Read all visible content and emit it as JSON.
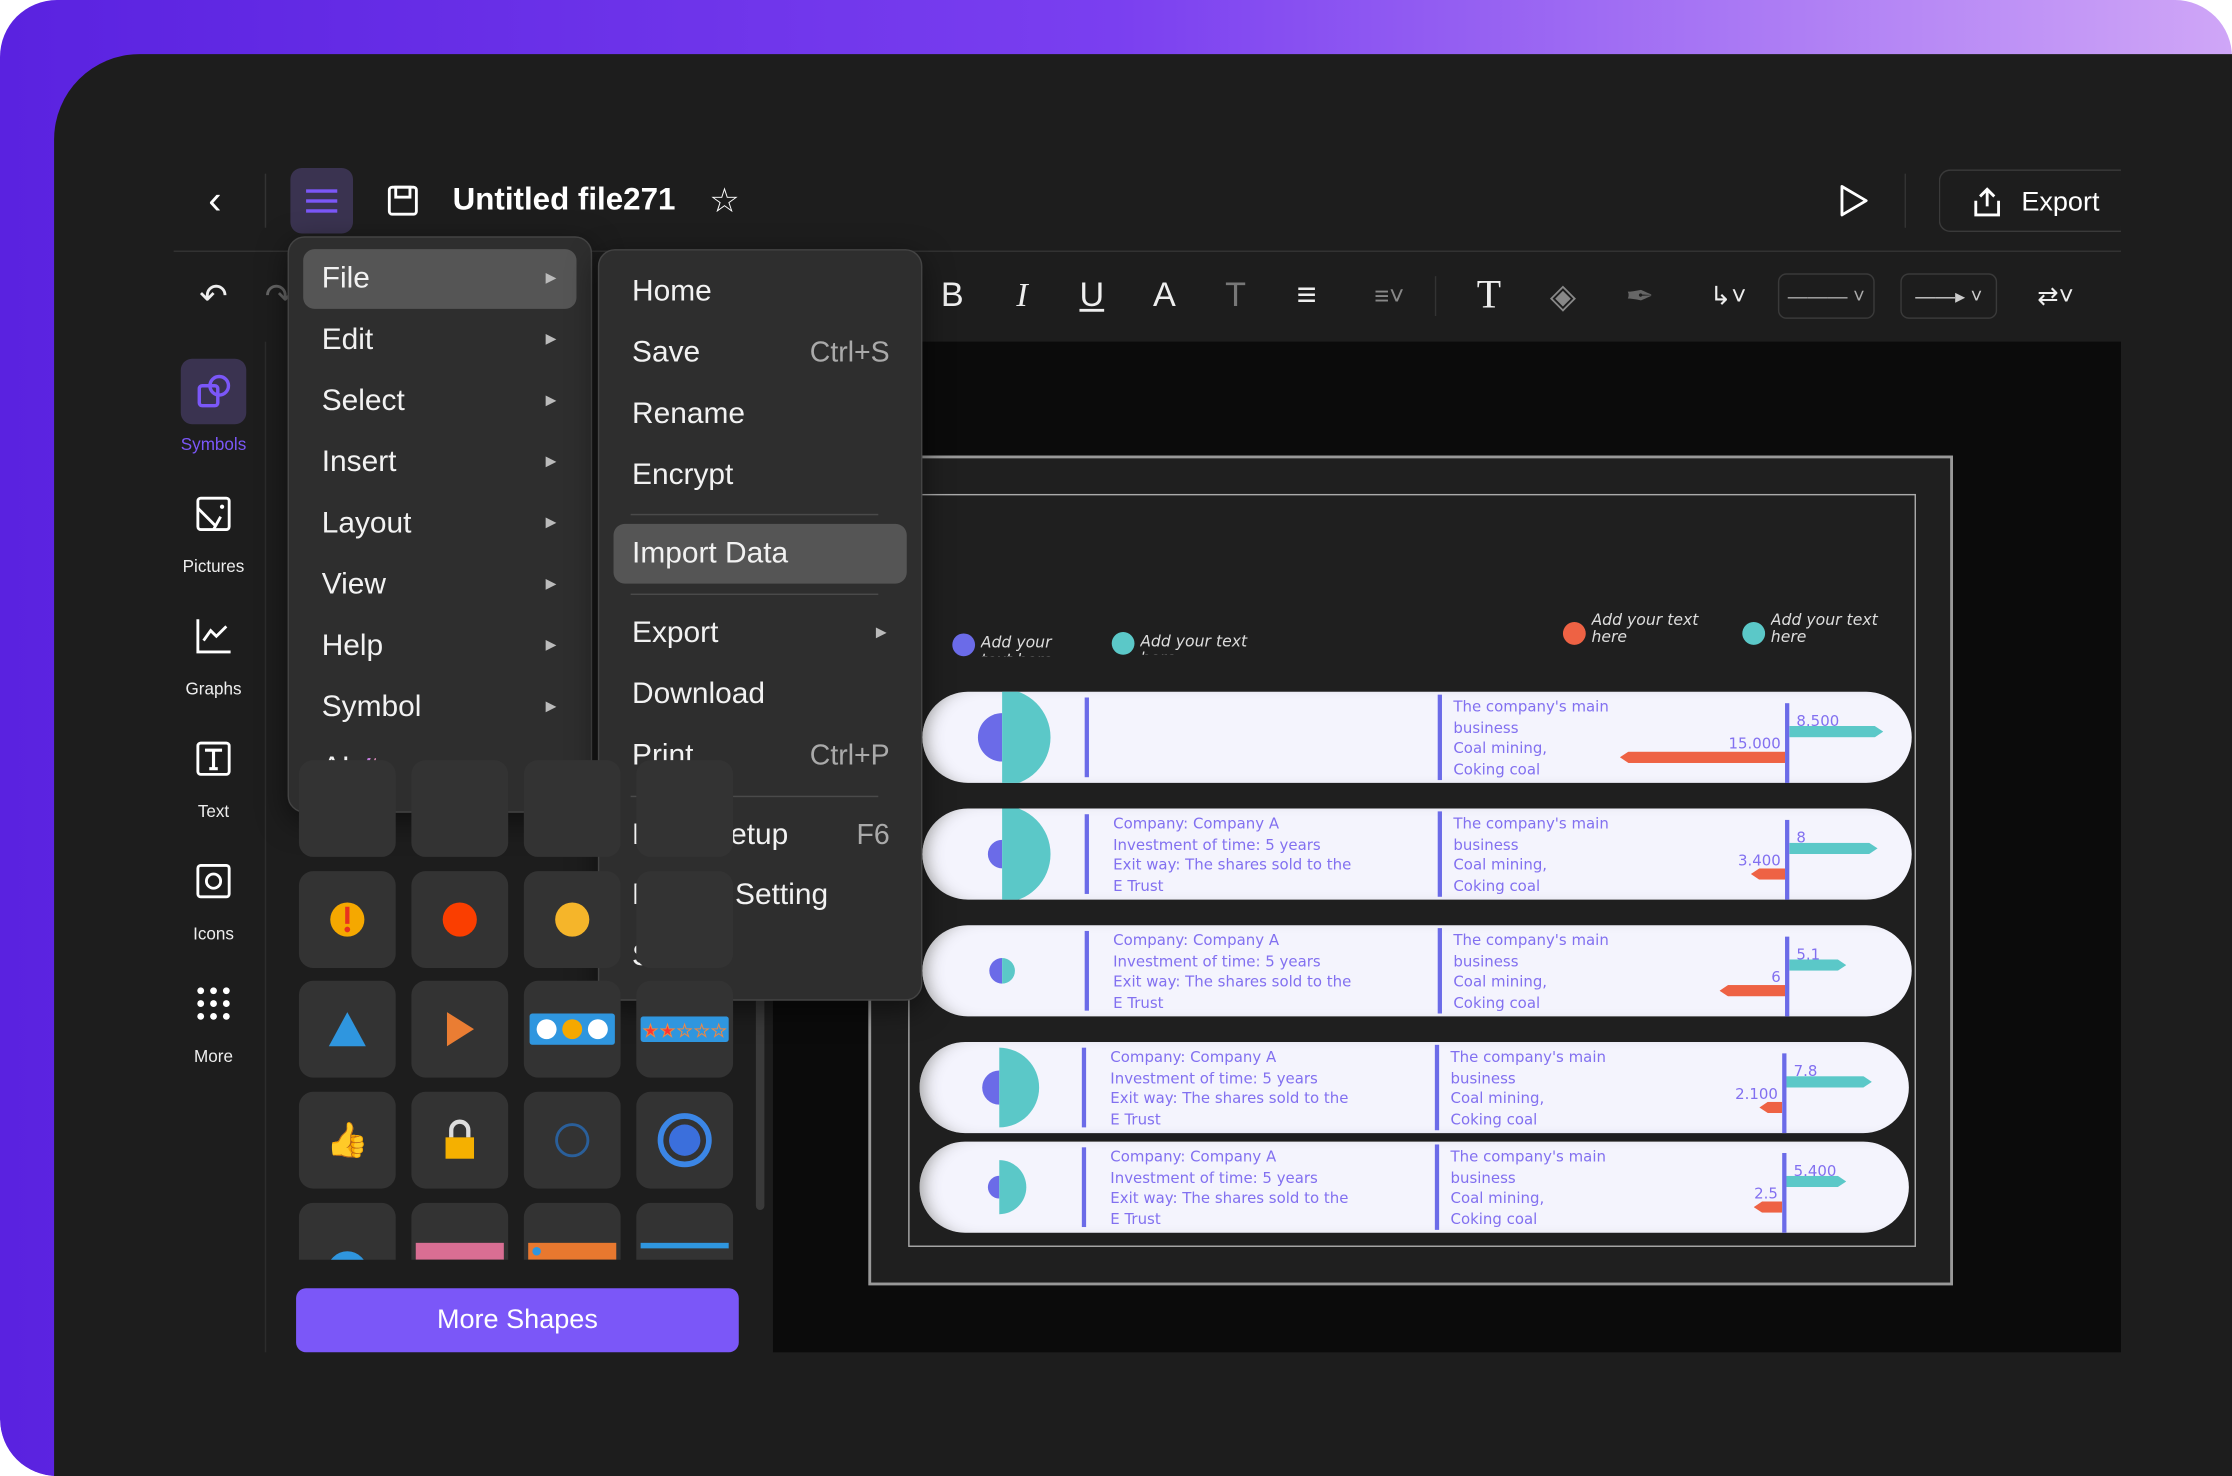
{
  "header": {
    "title": "Untitled file271",
    "export_label": "Export"
  },
  "rail": [
    {
      "label": "Symbols",
      "icon": "symbols-icon",
      "active": true
    },
    {
      "label": "Pictures",
      "icon": "picture-icon"
    },
    {
      "label": "Graphs",
      "icon": "graph-icon"
    },
    {
      "label": "Text",
      "icon": "text-icon"
    },
    {
      "label": "Icons",
      "icon": "icons-icon"
    },
    {
      "label": "More",
      "icon": "more-grid-icon"
    }
  ],
  "panel": {
    "more_shapes_label": "More Shapes"
  },
  "main_menu": [
    {
      "label": "File"
    },
    {
      "label": "Edit"
    },
    {
      "label": "Select"
    },
    {
      "label": "Insert"
    },
    {
      "label": "Layout"
    },
    {
      "label": "View"
    },
    {
      "label": "Help"
    },
    {
      "label": "Symbol"
    },
    {
      "label": "AI"
    }
  ],
  "file_menu": [
    {
      "label": "Home"
    },
    {
      "label": "Save",
      "shortcut": "Ctrl+S"
    },
    {
      "label": "Rename"
    },
    {
      "label": "Encrypt"
    },
    {
      "label": "Import Data"
    },
    {
      "label": "Export"
    },
    {
      "label": "Download"
    },
    {
      "label": "Print",
      "shortcut": "Ctrl+P"
    },
    {
      "label": "Page Setup",
      "shortcut": "F6"
    },
    {
      "label": "Default Setting"
    },
    {
      "label": "Star"
    }
  ],
  "colors": {
    "accent": "#7b57f8",
    "purple": "#6b6be8",
    "teal": "#5bc8c8",
    "orange": "#ee6244"
  },
  "diagram": {
    "legend": [
      {
        "text": "Add your text here",
        "color": "#6b6be8"
      },
      {
        "text": "Add your text here",
        "color": "#5bc8c8"
      },
      {
        "text": "Add your text here",
        "color": "#ee6244"
      },
      {
        "text": "Add your text here",
        "color": "#5bc8c8"
      }
    ],
    "rows": [
      {
        "info": [],
        "business": [
          "The company's main",
          "business",
          "Coal mining,",
          "Coking coal"
        ],
        "right_value": "8.500",
        "left_value": "15.000"
      },
      {
        "info": [
          "Company: Company A",
          "Investment of time: 5 years",
          "Exit way: The shares sold to the",
          "E Trust"
        ],
        "business": [
          "The company's main",
          "business",
          "Coal mining,",
          "Coking coal"
        ],
        "right_value": "8",
        "left_value": "3.400"
      },
      {
        "info": [
          "Company: Company A",
          "Investment of time: 5 years",
          "Exit way: The shares sold to the",
          "E Trust"
        ],
        "business": [
          "The company's main",
          "business",
          "Coal mining,",
          "Coking coal"
        ],
        "right_value": "5.1",
        "left_value": "6"
      },
      {
        "info": [
          "Company: Company A",
          "Investment of time: 5 years",
          "Exit way: The shares sold to the",
          "E Trust"
        ],
        "business": [
          "The company's main",
          "business",
          "Coal mining,",
          "Coking coal"
        ],
        "right_value": "7.8",
        "left_value": "2.100"
      },
      {
        "info": [
          "Company: Company A",
          "Investment of time: 5 years",
          "Exit way: The shares sold to the",
          "E Trust"
        ],
        "business": [
          "The company's main",
          "business",
          "Coal mining,",
          "Coking coal"
        ],
        "right_value": "5.400",
        "left_value": "2.5"
      }
    ]
  }
}
